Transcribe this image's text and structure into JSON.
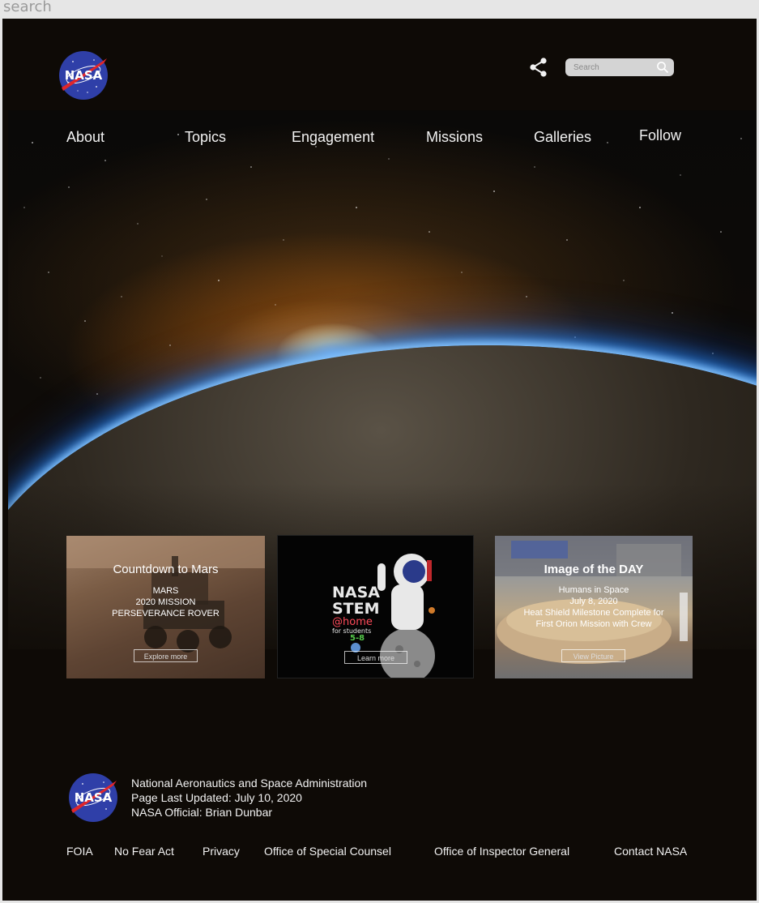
{
  "browser": {
    "search_text": "search"
  },
  "header": {
    "search": {
      "placeholder": "Search"
    }
  },
  "brand": {
    "logo_text": "NASA"
  },
  "nav": {
    "items": [
      {
        "label": "About"
      },
      {
        "label": "Topics"
      },
      {
        "label": "Engagement"
      },
      {
        "label": "Missions"
      },
      {
        "label": "Galleries"
      },
      {
        "label": "Follow"
      }
    ]
  },
  "cards": [
    {
      "title": "Countdown to Mars",
      "lines": [
        "MARS",
        "2020 MISSION",
        "PERSEVERANCE ROVER"
      ],
      "button": "Explore more"
    },
    {
      "title": "",
      "lines": [],
      "stem_logo": [
        "NASA",
        "STEM",
        "@home",
        "for students",
        "5-8"
      ],
      "button": "Learn more"
    },
    {
      "title": "Image of the DAY",
      "lines": [
        "Humans in Space",
        "July 8, 2020",
        "Heat Shield Milestone Complete for",
        "First Orion Mission with Crew"
      ],
      "button": "View Picture"
    }
  ],
  "footer": {
    "org": "National Aeronautics and Space Administration",
    "updated": "Page Last Updated: July 10, 2020",
    "official": "NASA Official: Brian Dunbar",
    "links": [
      {
        "label": "FOIA"
      },
      {
        "label": "No Fear Act"
      },
      {
        "label": "Privacy"
      },
      {
        "label": "Office of Special Counsel"
      },
      {
        "label": "Office of Inspector General"
      },
      {
        "label": "Contact NASA"
      }
    ]
  },
  "colors": {
    "page_bg": "#0e0a06",
    "nasa_blue": "#2f3fa8",
    "nasa_red": "#e0262b",
    "text": "#f2f2f2"
  }
}
